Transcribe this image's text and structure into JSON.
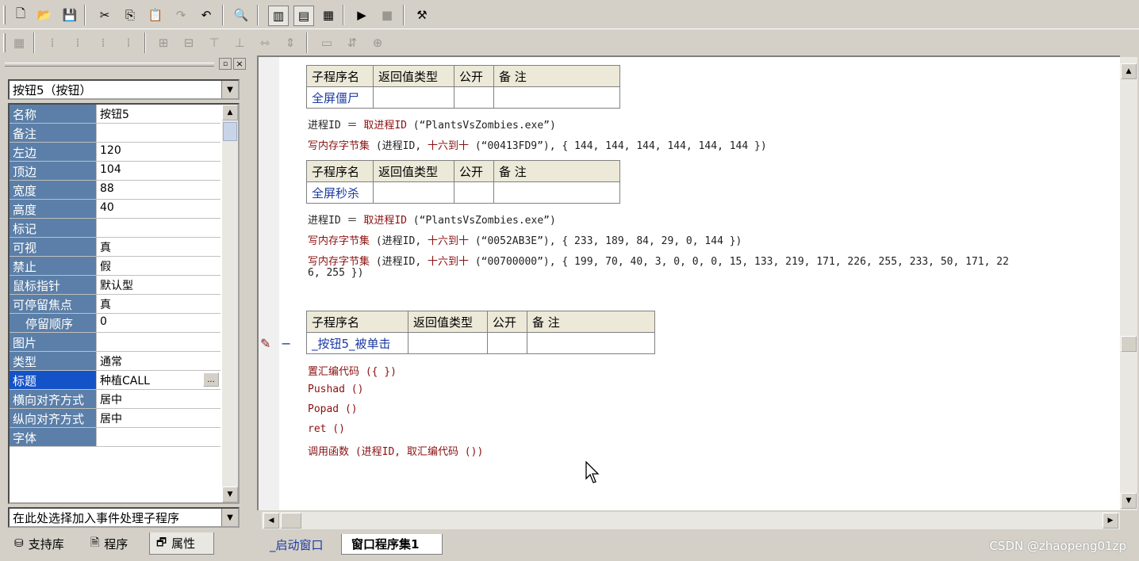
{
  "toolbar1": {
    "buttons": [
      "new-file-icon",
      "open-folder-icon",
      "save-icon",
      "cut-icon",
      "copy-icon",
      "paste-icon",
      "redo-icon",
      "undo-icon",
      "find-icon",
      "layout-1-icon",
      "layout-2-icon",
      "layout-3-icon",
      "run-icon",
      "stop-icon",
      "debug-icon"
    ],
    "glyphs": {
      "new": "🗋",
      "open": "📂",
      "save": "💾",
      "cut": "✂",
      "copy": "⎘",
      "paste": "📋",
      "redo": "↷",
      "undo": "↶",
      "find": "🔍",
      "l1": "▥",
      "l2": "▤",
      "l3": "▦",
      "run": "▶",
      "stop": "■",
      "debug": "⚒"
    }
  },
  "toolbar2": {
    "glyphs": [
      "▦",
      "⁞",
      "⁞",
      "⁞",
      "⁞",
      "⊞",
      "⊟",
      "⊤",
      "⊥",
      "⇿",
      "⇕",
      "▭",
      "⇵",
      "⊕"
    ]
  },
  "left_panel": {
    "object_selector": "按钮5（按钮）",
    "properties": [
      {
        "name": "名称",
        "value": "按钮5"
      },
      {
        "name": "备注",
        "value": ""
      },
      {
        "name": "左边",
        "value": "120"
      },
      {
        "name": "顶边",
        "value": "104"
      },
      {
        "name": "宽度",
        "value": "88"
      },
      {
        "name": "高度",
        "value": "40"
      },
      {
        "name": "标记",
        "value": ""
      },
      {
        "name": "可视",
        "value": "真"
      },
      {
        "name": "禁止",
        "value": "假"
      },
      {
        "name": "鼠标指针",
        "value": "默认型"
      },
      {
        "name": "可停留焦点",
        "value": "真"
      },
      {
        "name": "停留顺序",
        "value": "0"
      },
      {
        "name": "图片",
        "value": ""
      },
      {
        "name": "类型",
        "value": "通常"
      },
      {
        "name": "标题",
        "value": "种植CALL"
      },
      {
        "name": "横向对齐方式",
        "value": "居中"
      },
      {
        "name": "纵向对齐方式",
        "value": "居中"
      },
      {
        "name": "字体",
        "value": ""
      }
    ],
    "ellipsis": "...",
    "event_selector": "在此处选择加入事件处理子程序",
    "tabs": [
      {
        "label": "支持库",
        "icon": "library-icon"
      },
      {
        "label": "程序",
        "icon": "program-icon"
      },
      {
        "label": "属性",
        "icon": "properties-icon"
      }
    ]
  },
  "editor": {
    "headers": [
      "子程序名",
      "返回值类型",
      "公开",
      "备 注"
    ],
    "sub1_name": "全屏僵尸",
    "sub1_lines": [
      [
        "进程ID ＝ ",
        "取进程ID",
        " (“PlantsVsZombies.exe”)"
      ],
      [
        "写内存字节集",
        " (进程ID, ",
        "十六到十",
        " (“00413FD9”), { 144, 144, 144, 144, 144, 144 })"
      ]
    ],
    "sub2_name": "全屏秒杀",
    "sub2_lines": [
      [
        "进程ID ＝ ",
        "取进程ID",
        " (“PlantsVsZombies.exe”)"
      ],
      [
        "写内存字节集",
        " (进程ID, ",
        "十六到十",
        " (“0052AB3E”), { 233, 189, 84, 29, 0, 144 })"
      ],
      [
        "写内存字节集",
        " (进程ID, ",
        "十六到十",
        " (“00700000”), { 199, 70, 40, 3, 0, 0, 0, 15, 133, 219, 171, 226, 255, 233, 50, 171, 22"
      ],
      [
        "6, 255 })"
      ]
    ],
    "sub3_name": "_按钮5_被单击",
    "sub3_lines": [
      "置汇编代码 ({ })",
      "Pushad ()",
      "Popad ()",
      "ret ()",
      "调用函数 (进程ID, 取汇编代码 ())"
    ],
    "collapse_marker": "−",
    "bottom_tabs": [
      "_启动窗口",
      "窗口程序集1"
    ]
  },
  "watermark": "CSDN @zhaopeng01zp"
}
